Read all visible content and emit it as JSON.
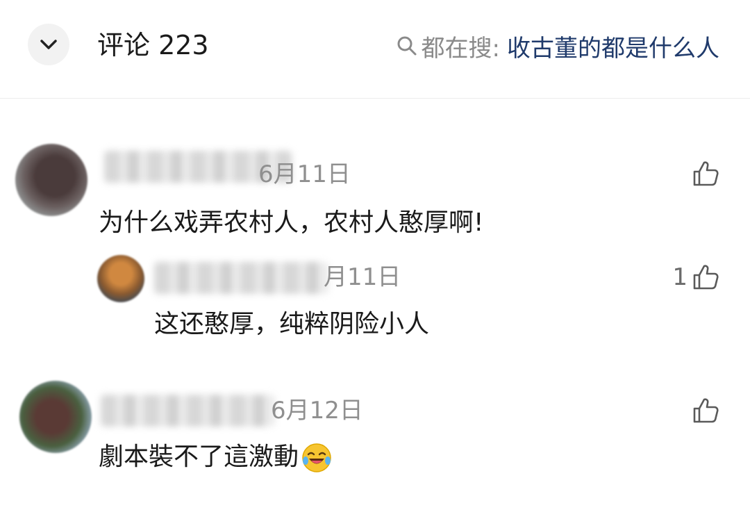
{
  "header": {
    "title": "评论 223",
    "search_prefix": "都在搜:",
    "search_query": "收古董的都是什么人"
  },
  "comments": [
    {
      "date": "6月11日",
      "text": "为什么戏弄农村人，农村人憨厚啊!",
      "like_count": "",
      "reply": {
        "date": "月11日",
        "text": "这还憨厚，纯粹阴险小人",
        "like_count": "1"
      }
    },
    {
      "date": "6月12日",
      "text": "劇本裝不了這激動",
      "emoji": "laughing-crying-emoji",
      "like_count": ""
    }
  ],
  "icons": {
    "collapse": "chevron-down-icon",
    "search": "search-icon",
    "like": "thumbs-up-icon"
  }
}
